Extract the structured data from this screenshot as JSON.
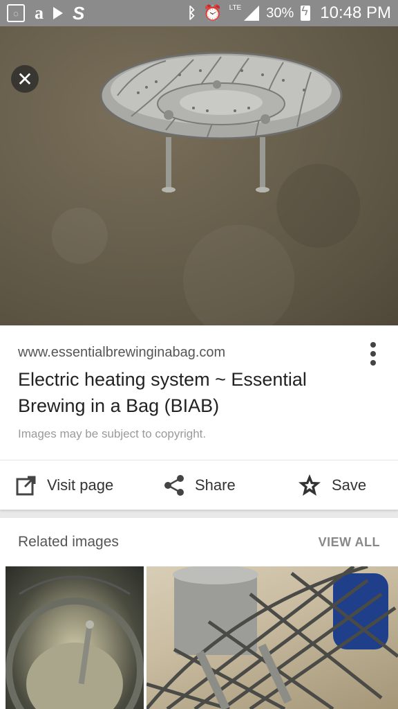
{
  "status_bar": {
    "left_icons": [
      "notification-square-icon",
      "amazon-icon",
      "play-icon",
      "s-app-icon"
    ],
    "right_icons": [
      "bluetooth-icon",
      "alarm-icon",
      "lte-signal-icon",
      "battery-charging-icon"
    ],
    "lte_label": "LTE",
    "battery_percent": "30%",
    "time": "10:48 PM"
  },
  "viewer": {
    "close_icon": "close-icon"
  },
  "result": {
    "url": "www.essentialbrewinginabag.com",
    "title": "Electric heating system ~ Essential Brewing in a Bag (BIAB)",
    "copyright_note": "Images may be subject to copyright."
  },
  "actions": {
    "visit_label": "Visit page",
    "share_label": "Share",
    "save_label": "Save"
  },
  "related": {
    "title": "Related images",
    "view_all_label": "VIEW ALL"
  }
}
